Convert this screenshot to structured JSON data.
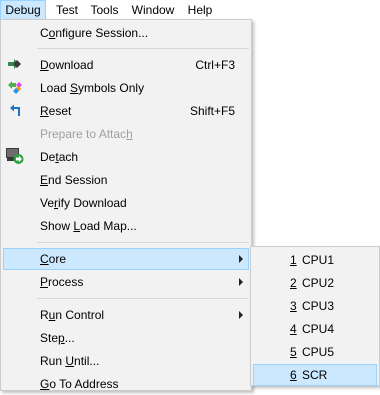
{
  "menubar": {
    "items": [
      {
        "label": "Debug",
        "active": true
      },
      {
        "label": "Test",
        "active": false
      },
      {
        "label": "Tools",
        "active": false
      },
      {
        "label": "Window",
        "active": false
      },
      {
        "label": "Help",
        "active": false
      }
    ]
  },
  "debug_menu": {
    "configure_session": {
      "pre": "C",
      "u": "o",
      "post": "nfigure Session..."
    },
    "download": {
      "pre": "",
      "u": "D",
      "post": "ownload",
      "shortcut": "Ctrl+F3",
      "icon": "download-icon"
    },
    "load_symbols": {
      "pre": "Load ",
      "u": "S",
      "post": "ymbols Only",
      "icon": "load-symbols-icon"
    },
    "reset": {
      "pre": "",
      "u": "R",
      "post": "eset",
      "shortcut": "Shift+F5",
      "icon": "reset-icon"
    },
    "prepare_to_attach": {
      "pre": "Prepare to Attac",
      "u": "h",
      "post": "",
      "disabled": true
    },
    "detach": {
      "pre": "De",
      "u": "t",
      "post": "ach",
      "icon": "detach-icon"
    },
    "end_session": {
      "pre": "",
      "u": "E",
      "post": "nd Session"
    },
    "verify_download": {
      "pre": "Ve",
      "u": "r",
      "post": "ify Download"
    },
    "show_load_map": {
      "pre": "Show ",
      "u": "L",
      "post": "oad Map..."
    },
    "core": {
      "pre": "",
      "u": "C",
      "post": "ore"
    },
    "process": {
      "pre": "",
      "u": "P",
      "post": "rocess"
    },
    "run_control": {
      "pre": "R",
      "u": "u",
      "post": "n Control"
    },
    "step": {
      "pre": "Ste",
      "u": "p",
      "post": "..."
    },
    "run_until": {
      "pre": "Run ",
      "u": "U",
      "post": "ntil..."
    },
    "go_to_address": {
      "pre": "",
      "u": "G",
      "post": "o To Address"
    }
  },
  "core_submenu": {
    "items": [
      {
        "num": "1",
        "label": "CPU1"
      },
      {
        "num": "2",
        "label": "CPU2"
      },
      {
        "num": "3",
        "label": "CPU3"
      },
      {
        "num": "4",
        "label": "CPU4"
      },
      {
        "num": "5",
        "label": "CPU5"
      },
      {
        "num": "6",
        "label": "SCR"
      }
    ]
  },
  "colors": {
    "highlight_bg": "#cce8ff",
    "highlight_border": "#99d1ff",
    "menu_bg": "#f2f2f2",
    "disabled_text": "#a0a0a0"
  }
}
